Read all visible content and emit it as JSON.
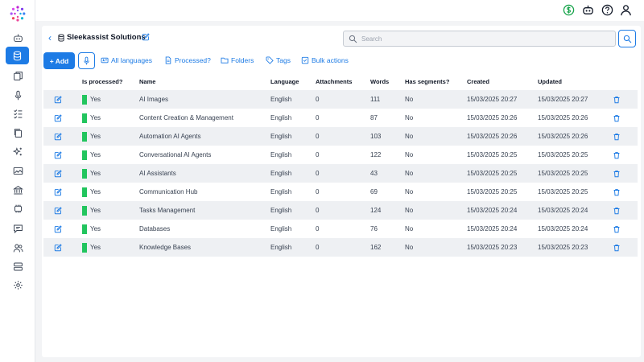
{
  "header": {
    "title": "Sleekassist Solutions",
    "search_placeholder": "Search"
  },
  "toolbar": {
    "add_label": "+ Add",
    "items": [
      {
        "label": "All languages",
        "icon": "language-icon"
      },
      {
        "label": "Processed?",
        "icon": "document-icon"
      },
      {
        "label": "Folders",
        "icon": "folder-icon"
      },
      {
        "label": "Tags",
        "icon": "tag-icon"
      },
      {
        "label": "Bulk actions",
        "icon": "checkbox-icon"
      }
    ]
  },
  "topbar_icons": [
    "dollar-circle-icon",
    "robot-icon",
    "help-icon",
    "user-icon"
  ],
  "sidebar_icons": [
    "robot-icon",
    "database-icon",
    "documents-icon",
    "microphone-icon",
    "checklist-icon",
    "copy-icon",
    "sparkles-icon",
    "image-icon",
    "bank-icon",
    "chip-icon",
    "chat-icon",
    "users-icon",
    "server-icon",
    "settings-icon"
  ],
  "colors": {
    "accent": "#1d7be5",
    "processed": "#22c55e",
    "row_alt": "#eef0f3"
  },
  "table": {
    "columns": [
      "Is processed?",
      "Name",
      "Language",
      "Attachments",
      "Words",
      "Has segments?",
      "Created",
      "Updated"
    ],
    "rows": [
      {
        "processed": "Yes",
        "name": "AI Images",
        "language": "English",
        "attachments": "0",
        "words": "111",
        "segments": "No",
        "created": "15/03/2025 20:27",
        "updated": "15/03/2025 20:27"
      },
      {
        "processed": "Yes",
        "name": "Content Creation & Management",
        "language": "English",
        "attachments": "0",
        "words": "87",
        "segments": "No",
        "created": "15/03/2025 20:26",
        "updated": "15/03/2025 20:26"
      },
      {
        "processed": "Yes",
        "name": "Automation AI Agents",
        "language": "English",
        "attachments": "0",
        "words": "103",
        "segments": "No",
        "created": "15/03/2025 20:26",
        "updated": "15/03/2025 20:26"
      },
      {
        "processed": "Yes",
        "name": "Conversational AI Agents",
        "language": "English",
        "attachments": "0",
        "words": "122",
        "segments": "No",
        "created": "15/03/2025 20:25",
        "updated": "15/03/2025 20:25"
      },
      {
        "processed": "Yes",
        "name": "AI Assistants",
        "language": "English",
        "attachments": "0",
        "words": "43",
        "segments": "No",
        "created": "15/03/2025 20:25",
        "updated": "15/03/2025 20:25"
      },
      {
        "processed": "Yes",
        "name": "Communication Hub",
        "language": "English",
        "attachments": "0",
        "words": "69",
        "segments": "No",
        "created": "15/03/2025 20:25",
        "updated": "15/03/2025 20:25"
      },
      {
        "processed": "Yes",
        "name": "Tasks Management",
        "language": "English",
        "attachments": "0",
        "words": "124",
        "segments": "No",
        "created": "15/03/2025 20:24",
        "updated": "15/03/2025 20:24"
      },
      {
        "processed": "Yes",
        "name": "Databases",
        "language": "English",
        "attachments": "0",
        "words": "76",
        "segments": "No",
        "created": "15/03/2025 20:24",
        "updated": "15/03/2025 20:24"
      },
      {
        "processed": "Yes",
        "name": "Knowledge Bases",
        "language": "English",
        "attachments": "0",
        "words": "162",
        "segments": "No",
        "created": "15/03/2025 20:23",
        "updated": "15/03/2025 20:23"
      }
    ]
  }
}
